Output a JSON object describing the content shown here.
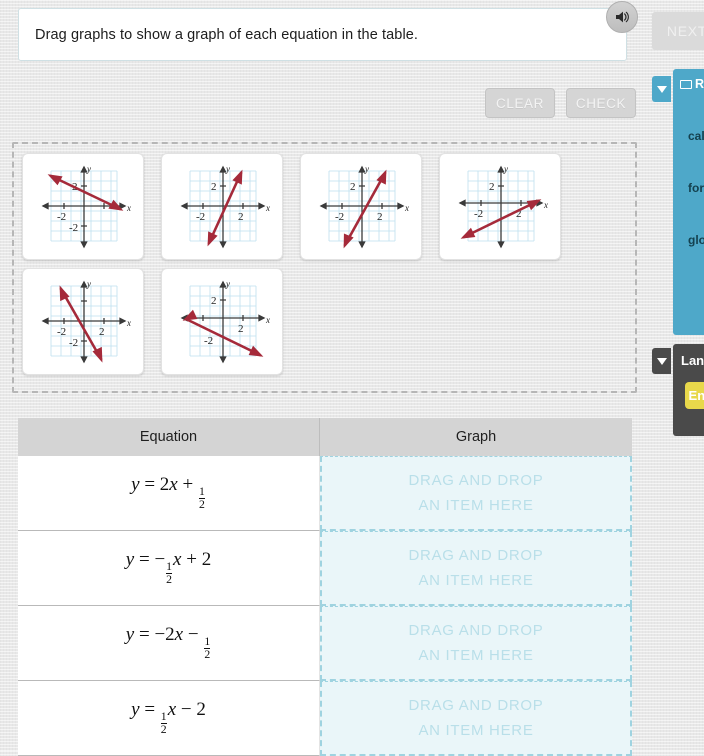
{
  "instruction": {
    "text": "Drag graphs to show a graph of each equation in the table.",
    "audio_icon": "speaker-icon"
  },
  "toolbar": {
    "clear_label": "CLEAR",
    "check_label": "CHECK"
  },
  "graph_bank": {
    "cards": [
      {
        "id": "graph-card-1",
        "slope": -0.5,
        "intercept": 2,
        "x_label": "x",
        "y_label": "y",
        "tick_labels": [
          "2",
          "-2",
          "-2"
        ]
      },
      {
        "id": "graph-card-2",
        "slope": 2,
        "intercept": 0.5,
        "x_label": "x",
        "y_label": "y",
        "tick_labels": [
          "2",
          "-2"
        ]
      },
      {
        "id": "graph-card-3",
        "slope": 2,
        "intercept": -0.5,
        "x_label": "x",
        "y_label": "y",
        "tick_labels": [
          "2",
          "-2"
        ]
      },
      {
        "id": "graph-card-4",
        "slope": 0.5,
        "intercept": -2,
        "x_label": "x",
        "y_label": "y",
        "tick_labels": [
          "2",
          "-2"
        ]
      },
      {
        "id": "graph-card-5",
        "slope": -2,
        "intercept": -0.5,
        "x_label": "x",
        "y_label": "y",
        "tick_labels": [
          "2",
          "-2",
          "-2"
        ]
      },
      {
        "id": "graph-card-6",
        "slope": -0.5,
        "intercept": -2,
        "x_label": "x",
        "y_label": "y",
        "tick_labels": [
          "2",
          "2",
          "-2"
        ]
      }
    ]
  },
  "table": {
    "headers": {
      "equation": "Equation",
      "graph": "Graph"
    },
    "dropzone_line1": "DRAG AND DROP",
    "dropzone_line2": "AN ITEM HERE",
    "rows": [
      {
        "equation_plain": "y = 2x + 1/2",
        "lhs": "y",
        "eq": "=",
        "coef": "2",
        "var": "x",
        "op": "+",
        "frac_num": "1",
        "frac_den": "2",
        "const": ""
      },
      {
        "equation_plain": "y = -1/2 x + 2",
        "lhs": "y",
        "eq": "=",
        "coef": "",
        "var": "x",
        "op": "−",
        "frac_num": "1",
        "frac_den": "2",
        "const": "2"
      },
      {
        "equation_plain": "y = -2x - 1/2",
        "lhs": "y",
        "eq": "=",
        "coef": "2",
        "var": "x",
        "op": "−",
        "frac_num": "1",
        "frac_den": "2",
        "const": ""
      },
      {
        "equation_plain": "y = 1/2 x - 2",
        "lhs": "y",
        "eq": "=",
        "coef": "",
        "var": "x",
        "op": "−",
        "frac_num": "1",
        "frac_den": "2",
        "const": "2"
      }
    ]
  },
  "right_rail": {
    "next_label": "NEXT",
    "resources_panel": {
      "title": "Resources",
      "items": [
        "calculator",
        "formula sheet",
        "glossary"
      ],
      "collapse_icon": "chevron-down-icon"
    },
    "language_panel": {
      "title": "Language",
      "button_label": "English",
      "collapse_icon": "chevron-down-icon"
    }
  },
  "colors": {
    "accent_blue": "#4ea8c9",
    "line_red": "#a52a3a",
    "dropzone_bg": "#eaf6f9",
    "dropzone_border": "#9fd3e0",
    "dropzone_text": "#b9dfe9",
    "header_gray": "#d4d4d4",
    "page_bg": "#e8e8e8",
    "lang_yellow": "#e8d84b"
  }
}
